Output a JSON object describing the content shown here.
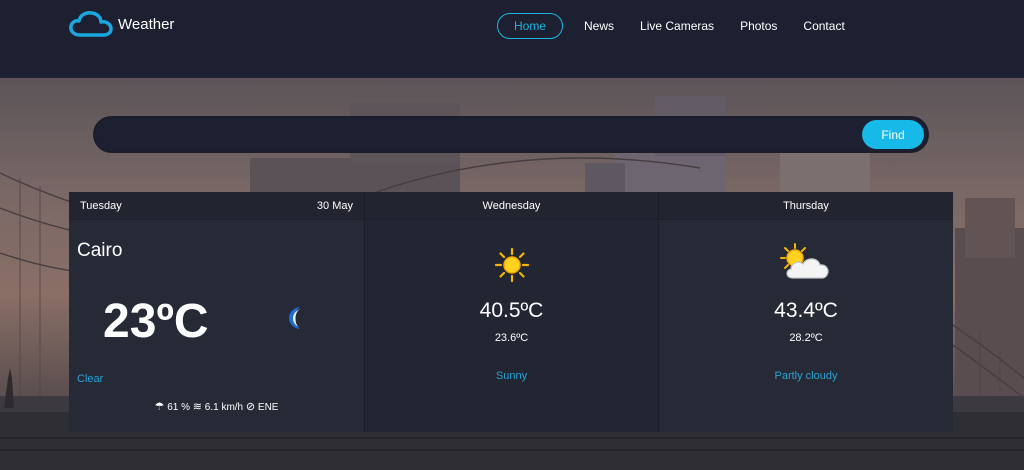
{
  "brand": {
    "name": "Weather"
  },
  "nav": [
    "Home",
    "News",
    "Live Cameras",
    "Photos",
    "Contact"
  ],
  "search": {
    "placeholder": "",
    "button": "Find"
  },
  "today": {
    "day": "Tuesday",
    "date": "30 May",
    "city": "Cairo",
    "temp": "23ºC",
    "condition": "Clear",
    "humidity": "61 %",
    "wind": "6.1 km/h",
    "direction": "ENE",
    "icon": "moon-icon"
  },
  "forecast": [
    {
      "day": "Wednesday",
      "max": "40.5ºC",
      "min": "23.6ºC",
      "condition": "Sunny",
      "icon": "sun-icon"
    },
    {
      "day": "Thursday",
      "max": "43.4ºC",
      "min": "28.2ºC",
      "condition": "Partly cloudy",
      "icon": "partly-cloudy-icon"
    }
  ],
  "colors": {
    "accent": "#16b9e8",
    "navbar": "#1d2030",
    "card": "#262936",
    "condition": "#2aa3d6"
  }
}
